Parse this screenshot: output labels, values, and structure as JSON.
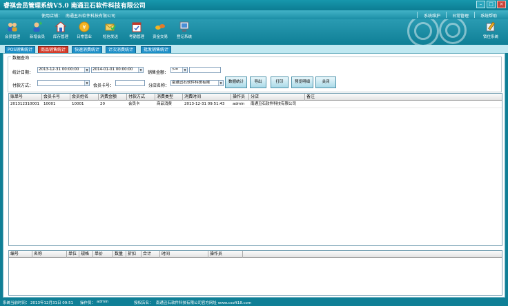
{
  "app": {
    "title": "睿祺会员管理系统V5.0 南通丑石软件科技有限公司",
    "store_label": "使用店铺：",
    "store_name": "南通丑石软件科技有限公司"
  },
  "top_menu": [
    "系统维护",
    "日常管理",
    "系统帮助"
  ],
  "toolbar": [
    {
      "label": "会员管理",
      "icon": "members-icon"
    },
    {
      "label": "新增会员",
      "icon": "add-member-icon"
    },
    {
      "label": "库存管理",
      "icon": "warehouse-icon"
    },
    {
      "label": "日常营业",
      "icon": "daily-business-icon"
    },
    {
      "label": "短信发送",
      "icon": "sms-icon"
    },
    {
      "label": "考勤管理",
      "icon": "attendance-icon"
    },
    {
      "label": "资金交易",
      "icon": "money-transaction-icon"
    },
    {
      "label": "登记系统",
      "icon": "register-system-icon"
    }
  ],
  "lock_system_label": "锁住系统",
  "tabs": [
    {
      "label": "POS销售统计",
      "active": false
    },
    {
      "label": "商品销售统计",
      "active": true
    },
    {
      "label": "快速消费统计",
      "active": false
    },
    {
      "label": "计次消费统计",
      "active": false
    },
    {
      "label": "批发销售统计",
      "active": false
    }
  ],
  "query": {
    "group_title": "数据查询",
    "date_label": "统计日期：",
    "date_from": "2013-12-31 00:00:00",
    "date_to": "2014-01-01 00:00:00",
    "amount_label": "销售金额：",
    "amount_op": ">=",
    "amount_value": "",
    "pay_label": "付款方式：",
    "pay_value": "",
    "card_label": "会员卡号：",
    "card_value": "",
    "branch_label": "分店名称：",
    "branch_value": "南通丑石软件科技有限",
    "buttons": [
      "数据统计",
      "导出",
      "打印",
      "预览明细",
      "关闭"
    ]
  },
  "main_table": {
    "columns": [
      "账单号",
      "会员卡号",
      "会员姓名",
      "消费金额",
      "付款方式",
      "消费类型",
      "消费时间",
      "操作员",
      "分店",
      "备注"
    ],
    "rows": [
      [
        "201312310001",
        "10001",
        "10001",
        "20",
        "会员卡",
        "商品消费",
        "2013-12-31 09:51:43",
        "admin",
        "南通丑石软件科技有限公司",
        ""
      ]
    ]
  },
  "detail_table": {
    "columns": [
      "编号",
      "名称",
      "单位",
      "规格",
      "单价",
      "数量",
      "折扣",
      "合计",
      "时间",
      "操作员"
    ]
  },
  "status": {
    "time_label": "系统当前时间：",
    "time_value": "2013年12月31日 09:51",
    "operator_label": "操作员：",
    "operator_value": "admin",
    "license_label": "授权店名：",
    "license_value": "南通丑石软件科技有限公司官方网址 www.csoft18.com"
  },
  "colors": {
    "accent": "#0f7f96",
    "active_tab": "#d33b2a",
    "tab": "#1d8fc8"
  }
}
